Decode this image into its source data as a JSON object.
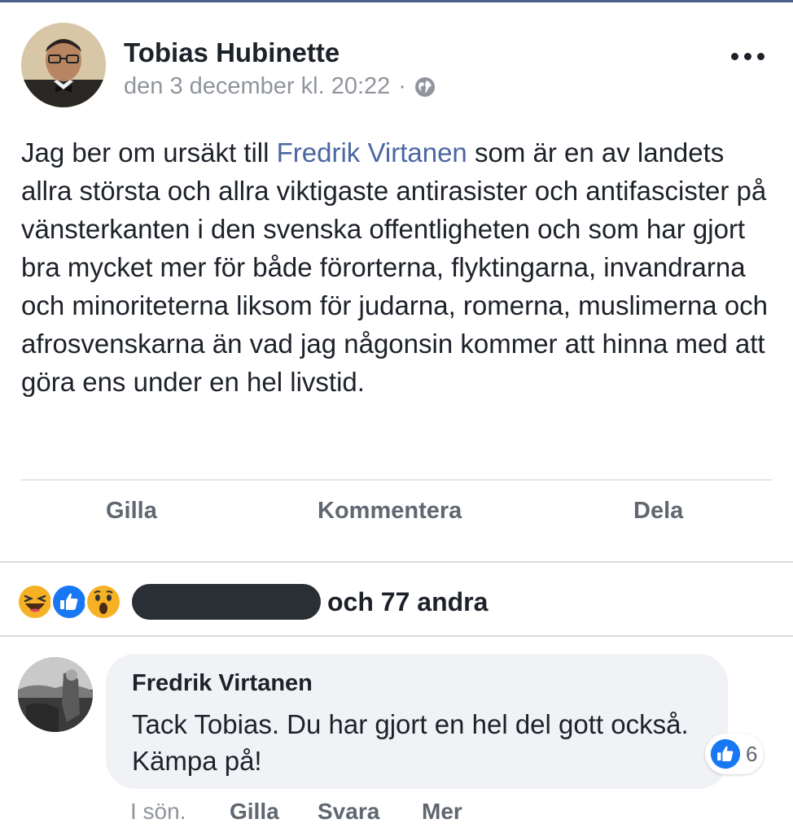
{
  "post": {
    "author": "Tobias Hubinette",
    "timestamp": "den 3 december kl. 20:22",
    "separator": "·",
    "privacy_icon": "globe-icon",
    "more_icon": "more-dots-icon",
    "body_before_mention": "Jag ber om ursäkt till ",
    "mention": "Fredrik Virtanen",
    "body_after_mention": " som är en av landets allra största och allra viktigaste antirasister och antifascister på vänsterkanten i den svenska offentligheten och som har gjort bra mycket mer för både förorterna, flyktingarna, invandrarna och minoriteterna liksom för judarna, romerna, muslimerna och afrosvenskarna än vad jag någonsin kommer att hinna med att göra ens under en hel livstid."
  },
  "actions": {
    "like": "Gilla",
    "comment": "Kommentera",
    "share": "Dela"
  },
  "reactions": {
    "icons": [
      "haha-icon",
      "like-icon",
      "wow-icon"
    ],
    "others": "och 77 andra"
  },
  "comment": {
    "author": "Fredrik Virtanen",
    "text": "Tack Tobias. Du har gjort en hel del gott också. Kämpa på!",
    "like_count": "6",
    "time": "I sön.",
    "like": "Gilla",
    "reply": "Svara",
    "more": "Mer"
  },
  "colors": {
    "mention": "#4b67a1",
    "like_blue": "#1877f2",
    "reaction_yellow": "#f7b125",
    "muted": "#90949c"
  }
}
